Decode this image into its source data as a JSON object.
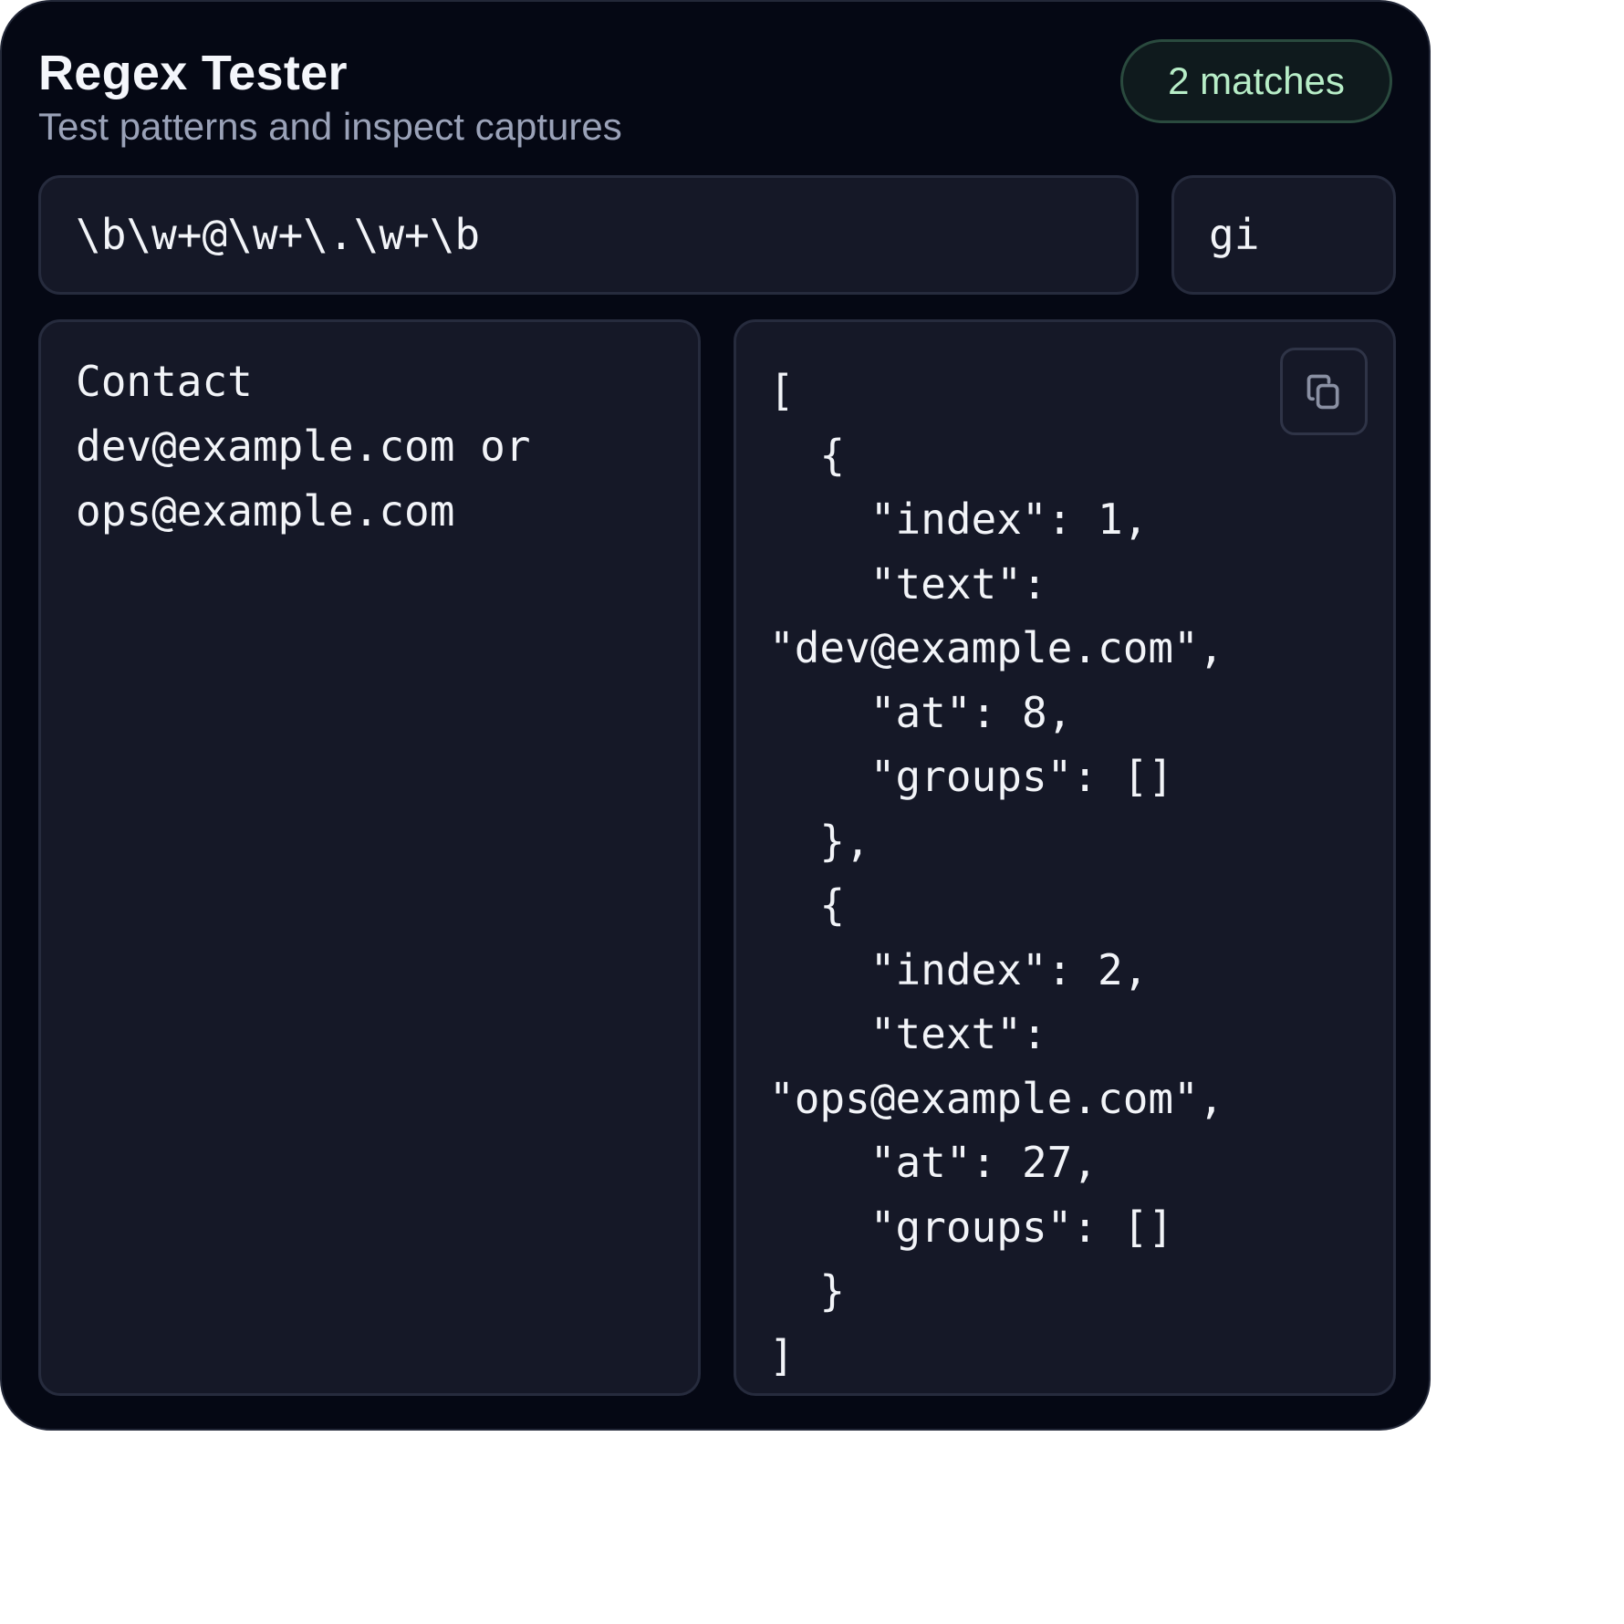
{
  "header": {
    "title": "Regex Tester",
    "subtitle": "Test patterns and inspect captures",
    "match_badge": "2 matches"
  },
  "pattern": {
    "value": "\\b\\w+@\\w+\\.\\w+\\b",
    "flags": "gi"
  },
  "input": {
    "text": "Contact\ndev@example.com or\nops@example.com"
  },
  "output": {
    "text": "[\n  {\n    \"index\": 1,\n    \"text\":\n\"dev@example.com\",\n    \"at\": 8,\n    \"groups\": []\n  },\n  {\n    \"index\": 2,\n    \"text\":\n\"ops@example.com\",\n    \"at\": 27,\n    \"groups\": []\n  }\n]",
    "copy_icon": "copy-icon"
  },
  "colors": {
    "background": "#050814",
    "panel": "#151827",
    "panel_border": "#262b3d",
    "badge_text": "#b7edc7",
    "badge_border": "#2a4a3e",
    "subtitle": "#9aa2b8"
  }
}
